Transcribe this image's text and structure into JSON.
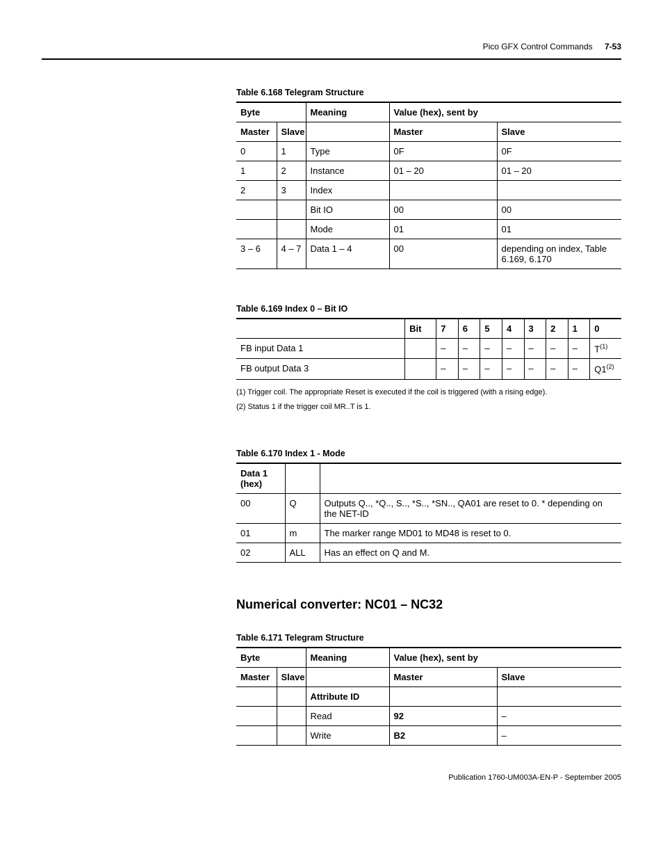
{
  "header": {
    "title": "Pico GFX Control Commands",
    "page": "7-53"
  },
  "table168": {
    "caption": "Table 6.168 Telegram Structure",
    "h_byte": "Byte",
    "h_meaning": "Meaning",
    "h_value": "Value (hex), sent by",
    "h_master": "Master",
    "h_slave": "Slave",
    "h_master2": "Master",
    "h_slave2": "Slave",
    "rows": {
      "r0": {
        "m": "0",
        "s": "1",
        "meaning": "Type",
        "vm": "0F",
        "vs": "0F"
      },
      "r1": {
        "m": "1",
        "s": "2",
        "meaning": "Instance",
        "vm": "01 – 20",
        "vs": "01 – 20"
      },
      "r2": {
        "m": "2",
        "s": "3",
        "meaning": "Index",
        "vm": "",
        "vs": ""
      },
      "r3": {
        "m": "",
        "s": "",
        "meaning": "Bit IO",
        "vm": "00",
        "vs": "00"
      },
      "r4": {
        "m": "",
        "s": "",
        "meaning": "Mode",
        "vm": "01",
        "vs": "01"
      },
      "r5": {
        "m": "3 – 6",
        "s": "4 – 7",
        "meaning": "Data 1 – 4",
        "vm": "00",
        "vs": "depending on index, Table 6.169, 6.170"
      }
    }
  },
  "table169": {
    "caption": "Table 6.169 Index 0 – Bit IO",
    "h_bit": "Bit",
    "b7": "7",
    "b6": "6",
    "b5": "5",
    "b4": "4",
    "b3": "3",
    "b2": "2",
    "b1": "1",
    "b0": "0",
    "row_in": {
      "label": "FB input Data 1",
      "c7": "–",
      "c6": "–",
      "c5": "–",
      "c4": "–",
      "c3": "–",
      "c2": "–",
      "c1": "–",
      "c0": "T",
      "sup": "(1)"
    },
    "row_out": {
      "label": "FB output Data 3",
      "c7": "–",
      "c6": "–",
      "c5": "–",
      "c4": "–",
      "c3": "–",
      "c2": "–",
      "c1": "–",
      "c0": "Q1",
      "sup": "(2)"
    },
    "fn1": "(1)   Trigger coil. The appropriate Reset is executed if the coil is triggered (with a rising edge).",
    "fn2": "(2)   Status 1 if the trigger coil MR..T is 1."
  },
  "table170": {
    "caption": "Table 6.170 Index 1 - Mode",
    "h_data": "Data 1 (hex)",
    "r0": {
      "d": "00",
      "c": "Q",
      "desc": "Outputs Q.., *Q.., S.., *S.., *SN.., QA01 are reset to 0. * depending on the NET-ID"
    },
    "r1": {
      "d": "01",
      "c": "m",
      "desc": "The marker range MD01 to MD48 is reset to 0."
    },
    "r2": {
      "d": "02",
      "c": "ALL",
      "desc": "Has an effect on Q and M."
    }
  },
  "section_title": "Numerical converter: NC01 – NC32",
  "table171": {
    "caption": "Table 6.171 Telegram Structure",
    "h_byte": "Byte",
    "h_meaning": "Meaning",
    "h_value": "Value (hex), sent by",
    "h_master": "Master",
    "h_slave": "Slave",
    "h_master2": "Master",
    "h_slave2": "Slave",
    "attr": "Attribute ID",
    "r_read": {
      "meaning": "Read",
      "vm": "92",
      "vs": "–"
    },
    "r_write": {
      "meaning": "Write",
      "vm": "B2",
      "vs": "–"
    }
  },
  "footer": "Publication 1760-UM003A-EN-P - September 2005"
}
